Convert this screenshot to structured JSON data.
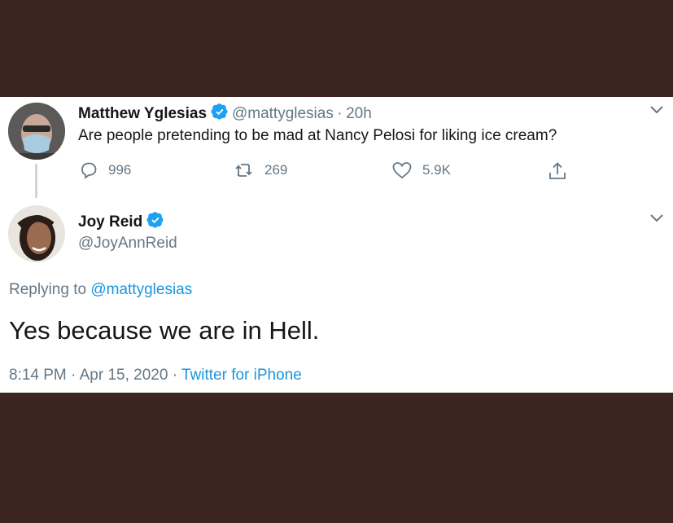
{
  "colors": {
    "background": "#3c2420",
    "card": "#ffffff",
    "primary_text": "#14171a",
    "secondary_text": "#657786",
    "link": "#1b95e0",
    "verified": "#1da1f2"
  },
  "parent_tweet": {
    "author_name": "Matthew Yglesias",
    "verified_icon": "verified-badge-icon",
    "handle": "@mattyglesias",
    "separator": "·",
    "time_ago": "20h",
    "text": "Are people pretending to be mad at Nancy Pelosi for liking ice cream?",
    "actions": {
      "replies": "996",
      "retweets": "269",
      "likes": "5.9K"
    },
    "icons": [
      "reply-icon",
      "retweet-icon",
      "like-icon",
      "share-icon",
      "chevron-down-icon"
    ]
  },
  "reply_tweet": {
    "author_name": "Joy Reid",
    "verified_icon": "verified-badge-icon",
    "handle": "@JoyAnnReid",
    "replying_prefix": "Replying to",
    "replying_to": "@mattyglesias",
    "text": "Yes because we are in Hell.",
    "time": "8:14 PM",
    "sep1": "·",
    "date": "Apr 15, 2020",
    "sep2": "·",
    "source": "Twitter for iPhone"
  }
}
